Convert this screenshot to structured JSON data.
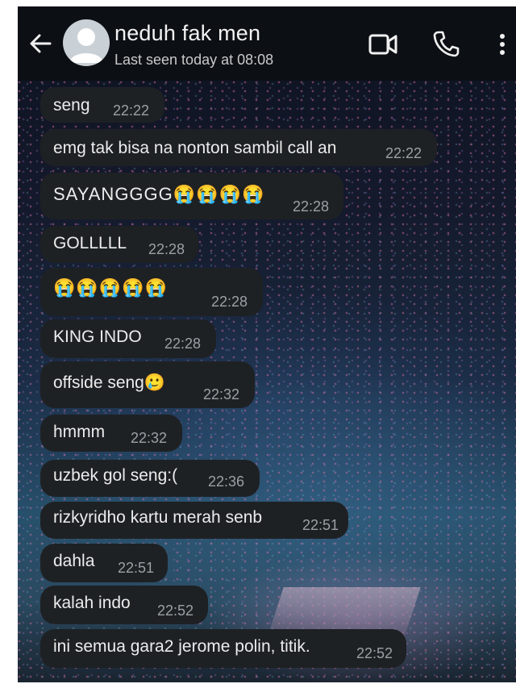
{
  "header": {
    "contact_name": "neduh fak men",
    "last_seen": "Last seen today at 08:08",
    "icons": {
      "back": "arrow-back-icon",
      "avatar": "default-avatar",
      "video": "video-call-icon",
      "call": "voice-call-icon",
      "menu": "more-vert-icon"
    }
  },
  "messages": [
    {
      "text": "seng",
      "time": "22:22"
    },
    {
      "text": "emg tak bisa na nonton sambil call an",
      "time": "22:22"
    },
    {
      "text": "SAYANGGGG😭😭😭😭",
      "time": "22:28"
    },
    {
      "text": "GOLLLLL",
      "time": "22:28"
    },
    {
      "text": "😭😭😭😭😭",
      "time": "22:28"
    },
    {
      "text": "KING INDO",
      "time": "22:28"
    },
    {
      "text": "offside seng🥲",
      "time": "22:32"
    },
    {
      "text": "hmmm",
      "time": "22:32"
    },
    {
      "text": "uzbek gol seng:(",
      "time": "22:36"
    },
    {
      "text": "rizkyridho kartu merah senb",
      "time": "22:51"
    },
    {
      "text": "dahla",
      "time": "22:51"
    },
    {
      "text": "kalah indo",
      "time": "22:52"
    },
    {
      "text": "ini semua gara2 jerome polin, titik.",
      "time": "22:52"
    }
  ],
  "colors": {
    "header_bg": "#0c0f14",
    "bubble_bg": "#1e2124",
    "text": "#ececec",
    "timestamp": "#9aa0a6"
  }
}
